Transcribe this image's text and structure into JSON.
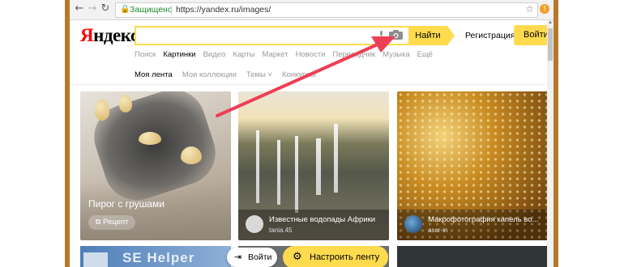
{
  "browser": {
    "back_icon": "arrow-left-icon",
    "forward_icon": "arrow-right-icon",
    "reload_icon": "reload-icon",
    "secure_label": "Защищено",
    "url": "https://yandex.ru/images/",
    "bookmark_icon": "star-icon",
    "extension_icon": "notification-icon"
  },
  "header": {
    "logo_first": "Я",
    "logo_rest": "ндекс",
    "search_placeholder": "",
    "find_label": "Найти",
    "register_label": "Регистрация",
    "login_label": "Войти"
  },
  "tabs": [
    "Поиск",
    "Картинки",
    "Видео",
    "Карты",
    "Маркет",
    "Новости",
    "Переводчик",
    "Музыка",
    "Ещё"
  ],
  "active_tab": "Картинки",
  "subtabs": [
    "Моя лента",
    "Мои коллекции",
    "Темы ˅",
    "Конкурсы"
  ],
  "cards": [
    {
      "title": "Пирог с грушами",
      "button": "Рецепт"
    },
    {
      "title": "Известные водопады Африки",
      "user": "tania.45"
    },
    {
      "title": "Макрофотография капель во...",
      "user": "asor-in"
    }
  ],
  "bottom": {
    "left_card_text": "SE Helper",
    "login_label": "Войти",
    "setup_label": "Настроить ленту"
  },
  "colors": {
    "accent": "#ffdb4d",
    "annotation": "#ee3e55",
    "logo_red": "#ff0000"
  }
}
